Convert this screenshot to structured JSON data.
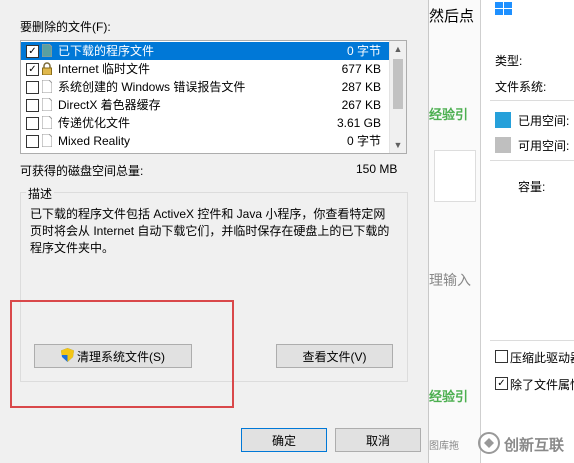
{
  "dialog": {
    "files_label": "要删除的文件(F):",
    "files": [
      {
        "name": "已下载的程序文件",
        "size": "0 字节",
        "checked": true,
        "selected": true
      },
      {
        "name": "Internet 临时文件",
        "size": "677 KB",
        "checked": true,
        "selected": false
      },
      {
        "name": "系统创建的 Windows 错误报告文件",
        "size": "287 KB",
        "checked": false,
        "selected": false
      },
      {
        "name": "DirectX 着色器缓存",
        "size": "267 KB",
        "checked": false,
        "selected": false
      },
      {
        "name": "传递优化文件",
        "size": "3.61 GB",
        "checked": false,
        "selected": false
      },
      {
        "name": "Mixed Reality",
        "size": "0 字节",
        "checked": false,
        "selected": false
      }
    ],
    "total_label": "可获得的磁盘空间总量:",
    "total_value": "150 MB",
    "description_title": "描述",
    "description_text": "已下载的程序文件包括 ActiveX 控件和 Java 小程序，你查看特定网页时将会从 Internet 自动下载它们，并临时保存在硬盘上的已下载的程序文件夹中。",
    "cleanup_button": "清理系统文件(S)",
    "view_files_button": "查看文件(V)",
    "ok_button": "确定",
    "cancel_button": "取消"
  },
  "background": {
    "top_text": "然后点",
    "green_text_1": "经验引",
    "input_text": "理输入",
    "green_text_2": "经验引",
    "bottom_text": "图库拖"
  },
  "properties": {
    "type_label": "类型:",
    "fs_label": "文件系统:",
    "used_label": "已用空间:",
    "free_label": "可用空间:",
    "capacity_label": "容量:",
    "compress_label": "压缩此驱动器",
    "index_label": "除了文件属性",
    "used_color": "#26a0da",
    "free_color": "#bfbfbf"
  },
  "watermark": {
    "text": "创新互联"
  }
}
